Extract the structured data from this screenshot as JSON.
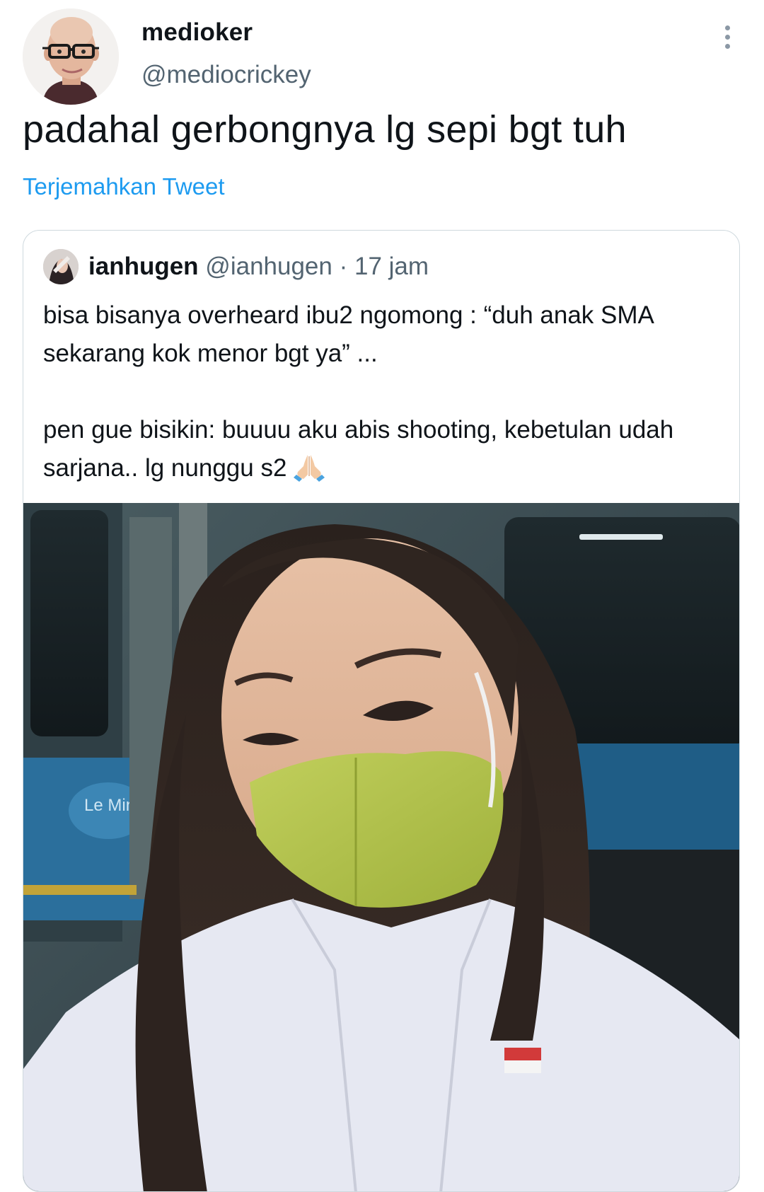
{
  "tweet": {
    "author": {
      "display_name": "medioker",
      "handle": "@mediocrickey",
      "avatar_icon": "bald-man-glasses-avatar"
    },
    "text": "padahal gerbongnya lg sepi bgt tuh",
    "translate_label": "Terjemahkan Tweet",
    "more_icon": "vertical-ellipsis-icon"
  },
  "quoted_tweet": {
    "author": {
      "display_name": "ianhugen",
      "handle": "@ianhugen",
      "avatar_icon": "profile-photo-avatar"
    },
    "separator": " · ",
    "timestamp": "17 jam",
    "text_line1": "bisa bisanya overheard ibu2 ngomong : “duh anak SMA sekarang kok menor bgt ya” ...",
    "text_line2": "pen gue bisikin: buuuu aku abis shooting, kebetulan udah sarjana.. lg nunggu s2",
    "emoji": "folded-hands-emoji",
    "media": {
      "type": "photo",
      "description_icon": "selfie-in-train-photo",
      "sticker_text": "Le Minerale"
    }
  },
  "colors": {
    "link": "#1d9bf0",
    "secondary_text": "#536471",
    "border": "#cfd9de"
  }
}
